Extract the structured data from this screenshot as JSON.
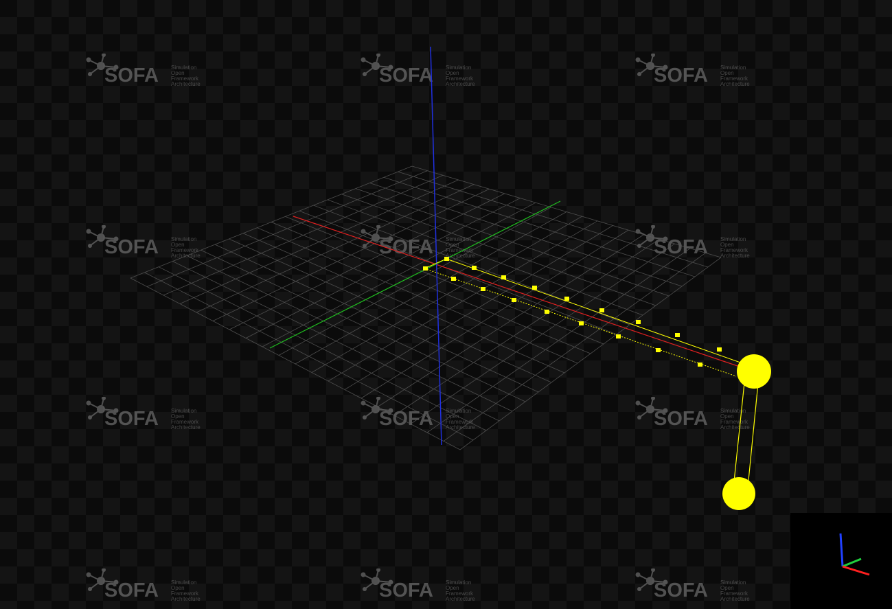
{
  "watermark": {
    "brand": "SOFA",
    "tagline": [
      "Simulation",
      "Open",
      "Framework",
      "Architecture"
    ]
  },
  "colors": {
    "background_dark": "#0b0b0b",
    "background_light": "#141414",
    "grid": "#5a5a5a",
    "axis_x": "#e02020",
    "axis_y": "#20c020",
    "axis_z": "#2030e0",
    "beam": "#ffff00",
    "logo": "#8a8a8a"
  },
  "icons": {
    "logo": "sofa-molecule-icon",
    "orientation": "xyz-axis-gizmo-icon"
  }
}
